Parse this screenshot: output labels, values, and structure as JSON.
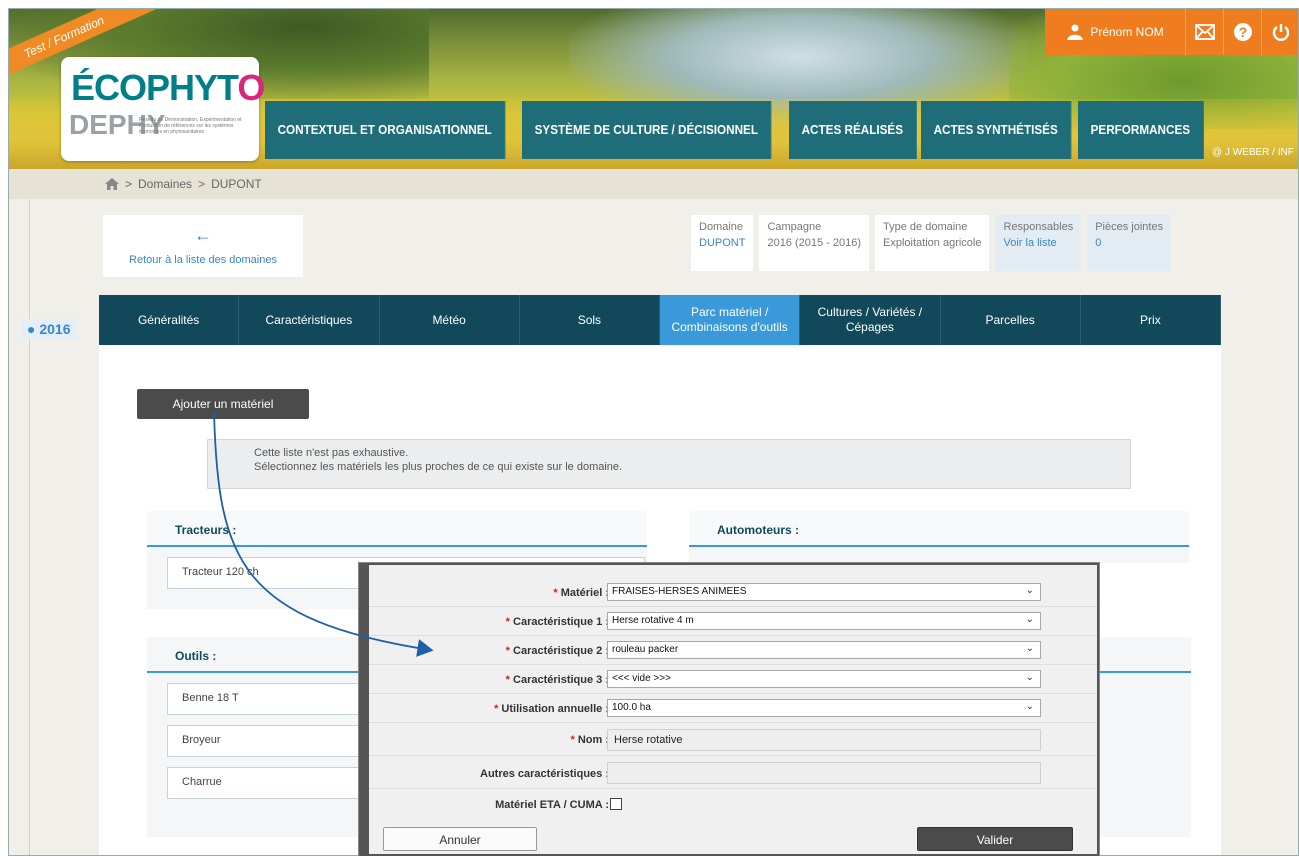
{
  "ribbon": "Test / Formation",
  "logo": {
    "line1": "ÉCOPHYT",
    "line1_o": "O",
    "line2": "DEPHY",
    "tagline": "Réseau de Démonstration, Expérimentation et Production de références sur les systèmes économes en phytosanitaires"
  },
  "mainnav": [
    "CONTEXTUEL ET ORGANISATIONNEL",
    "SYSTÈME DE CULTURE / DÉCISIONNEL",
    "ACTES RÉALISÉS",
    "ACTES SYNTHÉTISÉS",
    "PERFORMANCES"
  ],
  "user": {
    "name": "Prénom NOM"
  },
  "credit": "@ J WEBER / INF",
  "breadcrumb": {
    "domaines": "Domaines",
    "current": "DUPONT"
  },
  "year": "2016",
  "back": {
    "label": "Retour à la liste des domaines"
  },
  "infos": {
    "domaine": {
      "label": "Domaine",
      "value": "DUPONT"
    },
    "campagne": {
      "label": "Campagne",
      "value": "2016 (2015 - 2016)"
    },
    "type": {
      "label": "Type de domaine",
      "value": "Exploitation agricole"
    },
    "responsables": {
      "label": "Responsables",
      "value": "Voir la liste"
    },
    "pieces": {
      "label": "Pièces jointes",
      "value": "0"
    }
  },
  "tabs": [
    "Généralités",
    "Caractéristiques",
    "Météo",
    "Sols",
    "Parc matériel / Combinaisons d'outils",
    "Cultures / Variétés / Cépages",
    "Parcelles",
    "Prix"
  ],
  "add_button": "Ajouter un matériel",
  "note": {
    "line1": "Cette liste n'est pas exhaustive.",
    "line2": "Sélectionnez les matériels les plus proches de ce qui existe sur le domaine."
  },
  "tracteurs": {
    "title": "Tracteurs :",
    "items": [
      "Tracteur 120 ch"
    ]
  },
  "automoteurs": {
    "title": "Automoteurs :"
  },
  "outils": {
    "title": "Outils :",
    "items": [
      "Benne 18 T",
      "Broyeur",
      "Charrue"
    ]
  },
  "modal": {
    "materiel": {
      "label": "Matériel :",
      "value": "FRAISES-HERSES ANIMEES"
    },
    "car1": {
      "label": "Caractéristique 1 :",
      "value": "Herse rotative 4 m"
    },
    "car2": {
      "label": "Caractéristique 2 :",
      "value": "rouleau packer"
    },
    "car3": {
      "label": "Caractéristique 3 :",
      "value": "<<< vide >>>"
    },
    "utilisation": {
      "label": "Utilisation annuelle :",
      "value": "100.0 ha"
    },
    "nom": {
      "label": "Nom :",
      "value": "Herse rotative"
    },
    "autres": {
      "label": "Autres caractéristiques :",
      "value": ""
    },
    "eta": {
      "label": "Matériel ETA / CUMA :"
    },
    "annuler": "Annuler",
    "valider": "Valider"
  },
  "colors": {
    "teal_nav": "#1f6d78",
    "dark_tab": "#11495a",
    "active_tab": "#3a9ad9",
    "orange": "#ef7d1f",
    "required": "#d82020"
  },
  "icons": [
    "home-icon",
    "user-icon",
    "mail-icon",
    "help-icon",
    "power-icon",
    "arrow-left-icon",
    "chevron-down-icon"
  ]
}
